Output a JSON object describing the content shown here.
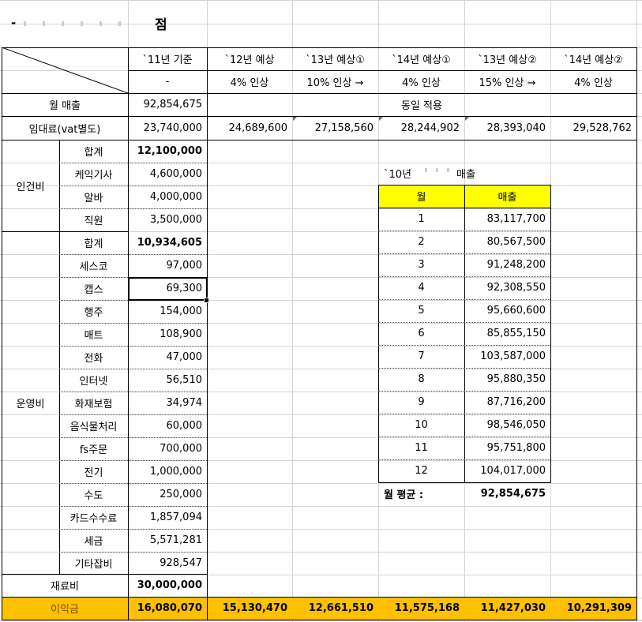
{
  "title": {
    "prefix": "-",
    "suffix": "점"
  },
  "headers": {
    "base": "`11년 기준",
    "base_rate": "-",
    "cols": [
      {
        "label": "`12년 예상",
        "rate": "4% 인상"
      },
      {
        "label": "`13년 예상①",
        "rate": "10% 인상 →"
      },
      {
        "label": "`14년 예상①",
        "rate": "4% 인상"
      },
      {
        "label": "`13년 예상②",
        "rate": "15% 인상 →"
      },
      {
        "label": "`14년 예상②",
        "rate": "4% 인상"
      }
    ]
  },
  "monthly_sales": {
    "label": "월 매출",
    "value": "92,854,675",
    "note": "동일 적용"
  },
  "rent": {
    "label": "임대료(vat별도)",
    "base": "23,740,000",
    "values": [
      "24,689,600",
      "27,158,560",
      "28,244,902",
      "28,393,040",
      "29,528,762"
    ]
  },
  "labor": {
    "group": "인건비",
    "items": [
      {
        "name": "합계",
        "value": "12,100,000"
      },
      {
        "name": "케익기사",
        "value": "4,600,000"
      },
      {
        "name": "알바",
        "value": "4,000,000"
      },
      {
        "name": "직원",
        "value": "3,500,000"
      }
    ]
  },
  "operating": {
    "group": "운영비",
    "items": [
      {
        "name": "합계",
        "value": "10,934,605"
      },
      {
        "name": "세스코",
        "value": "97,000"
      },
      {
        "name": "캡스",
        "value": "69,300"
      },
      {
        "name": "행주",
        "value": "154,000"
      },
      {
        "name": "매트",
        "value": "108,900"
      },
      {
        "name": "전화",
        "value": "47,000"
      },
      {
        "name": "인터넷",
        "value": "56,510"
      },
      {
        "name": "화재보험",
        "value": "34,974"
      },
      {
        "name": "음식물처리",
        "value": "60,000"
      },
      {
        "name": "fs주문",
        "value": "700,000"
      },
      {
        "name": "전기",
        "value": "1,000,000"
      },
      {
        "name": "수도",
        "value": "250,000"
      },
      {
        "name": "카드수수료",
        "value": "1,857,094"
      },
      {
        "name": "세금",
        "value": "5,571,281"
      },
      {
        "name": "기타잡비",
        "value": "928,547"
      }
    ]
  },
  "materials": {
    "label": "재료비",
    "value": "30,000,000"
  },
  "profit": {
    "label": "이익금",
    "base": "16,080,070",
    "values": [
      "15,130,470",
      "12,661,510",
      "11,575,168",
      "11,427,030",
      "10,291,309"
    ]
  },
  "sales_table": {
    "title_prefix": "`10년",
    "title_suffix": "매출",
    "headers": [
      "월",
      "매출"
    ],
    "rows": [
      [
        "1",
        "83,117,700"
      ],
      [
        "2",
        "80,567,500"
      ],
      [
        "3",
        "91,248,200"
      ],
      [
        "4",
        "92,308,550"
      ],
      [
        "5",
        "95,660,600"
      ],
      [
        "6",
        "85,855,150"
      ],
      [
        "7",
        "103,587,000"
      ],
      [
        "8",
        "95,880,350"
      ],
      [
        "9",
        "87,716,200"
      ],
      [
        "10",
        "98,546,050"
      ],
      [
        "11",
        "95,751,800"
      ],
      [
        "12",
        "104,017,000"
      ]
    ],
    "avg_label": "월  평균  :",
    "avg_value": "92,854,675"
  },
  "colors": {
    "yellow": "#ffff00",
    "orange": "#ffc000",
    "grid": "#d4d4d4"
  }
}
